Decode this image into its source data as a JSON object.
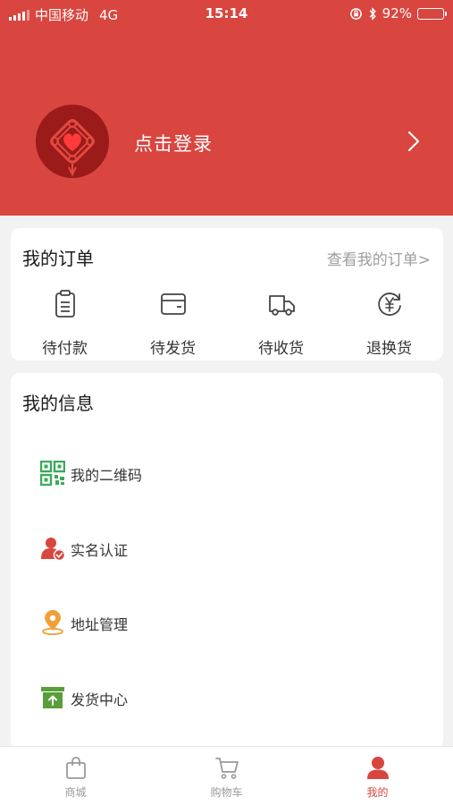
{
  "status_bar": {
    "carrier": "中国移动",
    "network": "4G",
    "time": "15:14",
    "battery": "92%",
    "battery_level": 0.92
  },
  "profile": {
    "login_text": "点击登录"
  },
  "orders": {
    "title": "我的订单",
    "view_all": "查看我的订单>",
    "items": [
      {
        "label": "待付款",
        "icon": "clipboard-icon"
      },
      {
        "label": "待发货",
        "icon": "wallet-icon"
      },
      {
        "label": "待收货",
        "icon": "truck-icon"
      },
      {
        "label": "退换货",
        "icon": "yen-refresh-icon"
      }
    ]
  },
  "info": {
    "title": "我的信息",
    "items": [
      {
        "label": "我的二维码",
        "icon": "qrcode-icon"
      },
      {
        "label": "实名认证",
        "icon": "verified-user-icon"
      },
      {
        "label": "地址管理",
        "icon": "location-pin-icon"
      },
      {
        "label": "发货中心",
        "icon": "shipping-box-icon"
      }
    ]
  },
  "tabbar": {
    "tabs": [
      {
        "label": "商城",
        "icon": "shopping-bag-icon",
        "active": false
      },
      {
        "label": "购物车",
        "icon": "cart-icon",
        "active": false
      },
      {
        "label": "我的",
        "icon": "person-icon",
        "active": true
      }
    ]
  },
  "colors": {
    "brand_red": "#d9453f",
    "active_tab": "#d9453f",
    "muted_text": "#9e9e9e",
    "qr_green": "#3aaa5c",
    "pin_orange": "#f0a13a",
    "box_green": "#5a9e3a"
  }
}
